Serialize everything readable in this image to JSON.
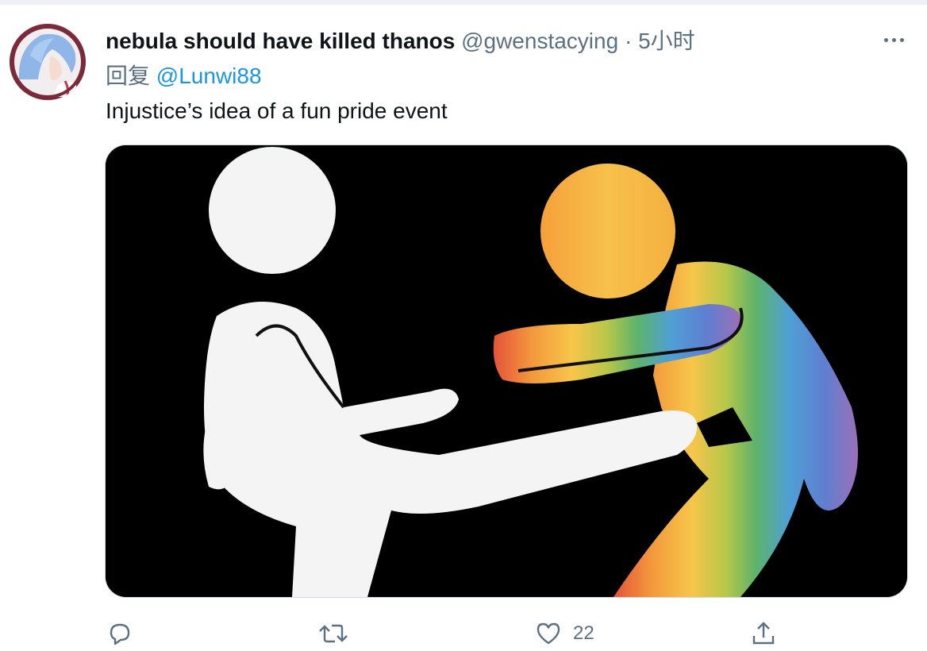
{
  "tweet": {
    "display_name": "nebula should have killed thanos",
    "handle": "@gwenstacying",
    "separator": "·",
    "time": "5小时",
    "reply_prefix": "回复",
    "reply_to": "@Lunwi88",
    "text": "Injustice’s idea of a fun pride event",
    "media_description_icon": "kick-pictogram-image"
  },
  "actions": {
    "reply_count": "",
    "retweet_count": "",
    "like_count": "22",
    "share_count": ""
  },
  "colors": {
    "text_primary": "#0f1419",
    "text_secondary": "#5b7083",
    "link": "#1b95e0",
    "media_bg": "#000000"
  }
}
